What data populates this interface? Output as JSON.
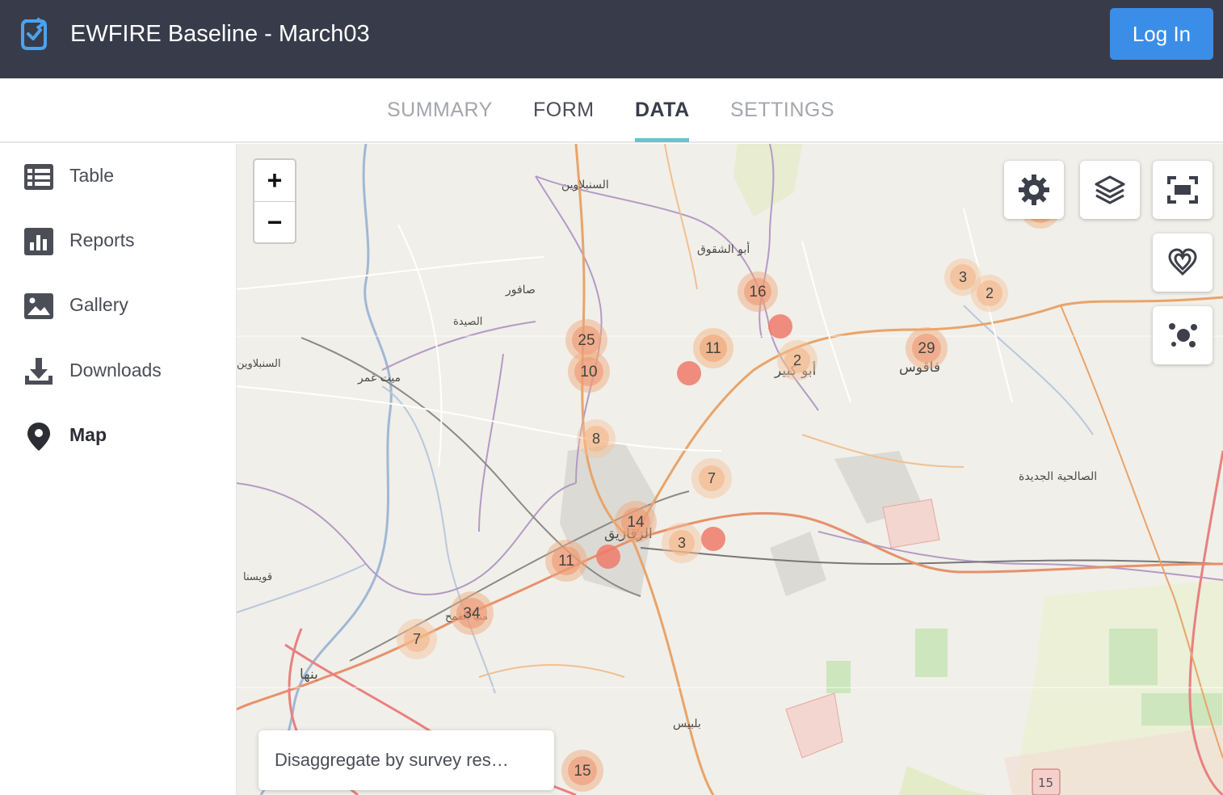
{
  "header": {
    "title": "EWFIRE Baseline - March03",
    "login_label": "Log In",
    "accent_color": "#3b8ee8"
  },
  "tabs": [
    {
      "label": "SUMMARY",
      "state": "inactive"
    },
    {
      "label": "FORM",
      "state": "inactive"
    },
    {
      "label": "DATA",
      "state": "active"
    },
    {
      "label": "SETTINGS",
      "state": "inactive"
    }
  ],
  "sidebar": {
    "items": [
      {
        "label": "Table",
        "icon": "table-icon"
      },
      {
        "label": "Reports",
        "icon": "bar-chart-icon"
      },
      {
        "label": "Gallery",
        "icon": "image-icon"
      },
      {
        "label": "Downloads",
        "icon": "download-icon"
      },
      {
        "label": "Map",
        "icon": "map-pin-icon",
        "active": true
      }
    ]
  },
  "map": {
    "zoom_in": "+",
    "zoom_out": "−",
    "controls": [
      "gear-icon",
      "layers-icon",
      "fullscreen-icon",
      "heatmap-icon",
      "cluster-icon"
    ],
    "disaggregate_label": "Disaggregate by survey res…",
    "clusters": [
      "16",
      "3",
      "2",
      "25",
      "11",
      "2",
      "29",
      "10",
      "8",
      "7",
      "14",
      "3",
      "11",
      "34",
      "7",
      "15"
    ],
    "place_labels": [
      "السنبلاوين",
      "أبو الشقوق",
      "صافور",
      "الصيدة",
      "ميت غمر",
      "أبو كبير",
      "فاقوس",
      "الصالحية الجديدة",
      "الزقازيق",
      "قويسنا",
      "بنها",
      "بلبيس",
      "منيا القمح",
      "السنبلاوين"
    ],
    "road_shield": "15"
  }
}
